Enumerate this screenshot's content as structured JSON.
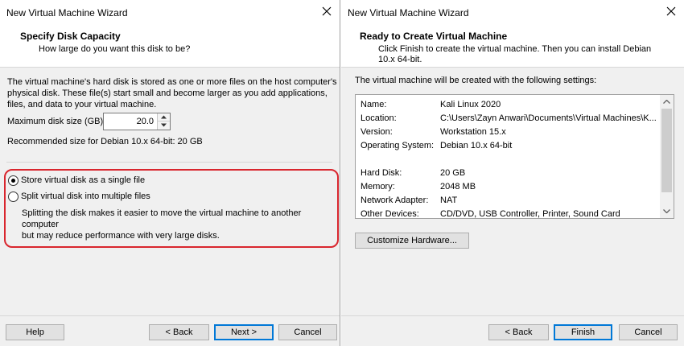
{
  "left": {
    "window_title": "New Virtual Machine Wizard",
    "header_title": "Specify Disk Capacity",
    "header_subtitle": "How large do you want this disk to be?",
    "description_lines": [
      "The virtual machine's hard disk is stored as one or more files on the host computer's",
      "physical disk. These file(s) start small and become larger as you add applications,",
      "files, and data to your virtual machine."
    ],
    "max_disk_label": "Maximum disk size (GB):",
    "max_disk_value": "20.0",
    "recommended_text": "Recommended size for Debian 10.x 64-bit: 20 GB",
    "option_single": "Store virtual disk as a single file",
    "option_split": "Split virtual disk into multiple files",
    "selected_option": "single",
    "split_note_lines": [
      "Splitting the disk makes it easier to move the virtual machine to another computer",
      "but may reduce performance with very large disks."
    ],
    "buttons": {
      "help": "Help",
      "back": "< Back",
      "next": "Next >",
      "cancel": "Cancel"
    }
  },
  "right": {
    "window_title": "New Virtual Machine Wizard",
    "header_title": "Ready to Create Virtual Machine",
    "header_subtitle_lines": [
      "Click Finish to create the virtual machine. Then you can install Debian",
      "10.x 64-bit."
    ],
    "intro_text": "The virtual machine will be created with the following settings:",
    "settings": [
      {
        "key": "Name:",
        "value": "Kali Linux 2020"
      },
      {
        "key": "Location:",
        "value": "C:\\Users\\Zayn Anwari\\Documents\\Virtual Machines\\K..."
      },
      {
        "key": "Version:",
        "value": "Workstation 15.x"
      },
      {
        "key": "Operating System:",
        "value": "Debian 10.x 64-bit"
      },
      {
        "key": "",
        "value": ""
      },
      {
        "key": "Hard Disk:",
        "value": "20 GB"
      },
      {
        "key": "Memory:",
        "value": "2048 MB"
      },
      {
        "key": "Network Adapter:",
        "value": "NAT"
      },
      {
        "key": "Other Devices:",
        "value": "CD/DVD, USB Controller, Printer, Sound Card"
      }
    ],
    "customize_label": "Customize Hardware...",
    "buttons": {
      "back": "< Back",
      "finish": "Finish",
      "cancel": "Cancel"
    }
  },
  "colors": {
    "highlight_border": "#d9262e",
    "default_button_border": "#0078d7",
    "dialog_bg": "#f0f0f0"
  },
  "icons": {
    "close": "close-icon",
    "spin_up": "chevron-up-icon",
    "spin_down": "chevron-down-icon",
    "scroll_up": "chevron-up-icon",
    "scroll_down": "chevron-down-icon"
  }
}
